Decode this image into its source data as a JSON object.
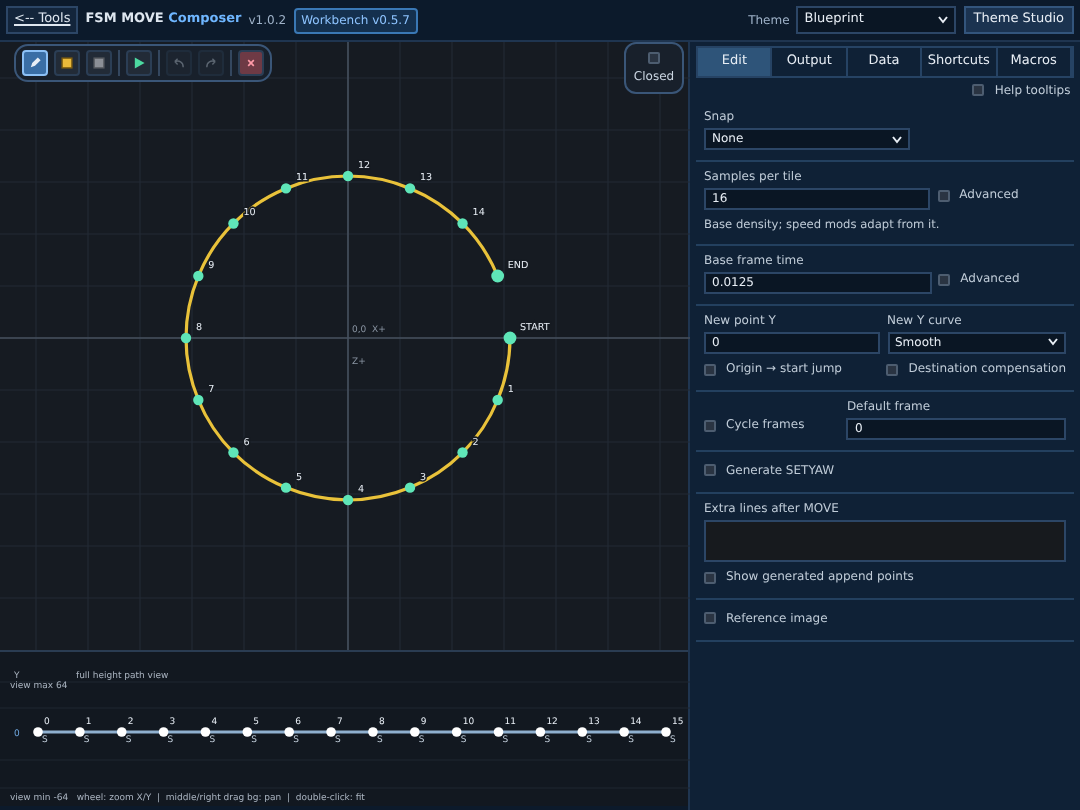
{
  "header": {
    "back_link": "<-- Tools",
    "title": "FSM MOVE",
    "title_accent": "Composer",
    "version": "v1.0.2",
    "badge": "Workbench v0.5.7",
    "theme_label": "Theme",
    "theme_value": "Blueprint",
    "theme_button": "Theme Studio"
  },
  "toolbar": [
    {
      "kind": "draw",
      "selected": true,
      "disabled": false
    },
    {
      "kind": "point",
      "selected": false,
      "disabled": false
    },
    {
      "kind": "erase",
      "selected": false,
      "disabled": false
    },
    {
      "kind": "play",
      "selected": false,
      "disabled": false
    },
    {
      "kind": "undo",
      "selected": false,
      "disabled": true
    },
    {
      "kind": "redo",
      "selected": false,
      "disabled": true
    },
    {
      "kind": "clear",
      "selected": false,
      "disabled": false
    }
  ],
  "closed_toggle": {
    "label": "Closed",
    "checked": false
  },
  "canvas": {
    "origin_label": "0,0  X+",
    "z_label": "Z+",
    "points": [
      "START",
      "1",
      "2",
      "3",
      "4",
      "5",
      "6",
      "7",
      "8",
      "9",
      "10",
      "11",
      "12",
      "13",
      "14",
      "END"
    ]
  },
  "timeline": {
    "y_label": "Y",
    "title": "full height path view",
    "max_label": "view max 64",
    "zero_label": "0",
    "points": [
      {
        "label": "0",
        "curve": "S"
      },
      {
        "label": "1",
        "curve": "S"
      },
      {
        "label": "2",
        "curve": "S"
      },
      {
        "label": "3",
        "curve": "S"
      },
      {
        "label": "4",
        "curve": "S"
      },
      {
        "label": "5",
        "curve": "S"
      },
      {
        "label": "6",
        "curve": "S"
      },
      {
        "label": "7",
        "curve": "S"
      },
      {
        "label": "8",
        "curve": "S"
      },
      {
        "label": "9",
        "curve": "S"
      },
      {
        "label": "10",
        "curve": "S"
      },
      {
        "label": "11",
        "curve": "S"
      },
      {
        "label": "12",
        "curve": "S"
      },
      {
        "label": "13",
        "curve": "S"
      },
      {
        "label": "14",
        "curve": "S"
      },
      {
        "label": "15",
        "curve": "S"
      }
    ],
    "footer": "view min -64   wheel: zoom X/Y  |  middle/right drag bg: pan  |  double-click: fit"
  },
  "tabs": [
    {
      "label": "Edit",
      "selected": true
    },
    {
      "label": "Output",
      "selected": false
    },
    {
      "label": "Data",
      "selected": false
    },
    {
      "label": "Shortcuts",
      "selected": false
    },
    {
      "label": "Macros",
      "selected": false
    }
  ],
  "help_tooltips": {
    "label": "Help tooltips",
    "checked": false
  },
  "sections": [
    {
      "rows": [
        [
          {
            "kind": "select",
            "label": "Snap",
            "value": "None"
          },
          {
            "kind": "empty"
          }
        ]
      ]
    },
    {
      "rows": [
        [
          {
            "kind": "input",
            "label": "Samples per tile",
            "value": "16"
          },
          {
            "kind": "checkbox",
            "label": "Advanced",
            "checked": false
          }
        ],
        [
          {
            "kind": "note",
            "text": "Base density; speed mods adapt from it."
          }
        ]
      ]
    },
    {
      "rows": [
        [
          {
            "kind": "input",
            "label": "Base frame time",
            "value": "0.0125"
          },
          {
            "kind": "checkbox",
            "label": "Advanced",
            "checked": false
          }
        ]
      ]
    },
    {
      "rows": [
        [
          {
            "kind": "input",
            "label": "New point Y",
            "value": "0"
          },
          {
            "kind": "select",
            "label": "New Y curve",
            "value": "Smooth"
          }
        ],
        [
          {
            "kind": "checkbox",
            "label": "Origin → start jump",
            "checked": false
          },
          {
            "kind": "checkbox",
            "label": "Destination compensation",
            "checked": false
          }
        ]
      ]
    },
    {
      "rows": [
        [
          {
            "kind": "checkbox",
            "label": "Cycle frames",
            "checked": false
          },
          {
            "kind": "input",
            "label": "Default frame",
            "value": "0"
          }
        ]
      ]
    },
    {
      "rows": [
        [
          {
            "kind": "checkbox",
            "label": "Generate SETYAW",
            "checked": false
          }
        ]
      ]
    },
    {
      "rows": [
        [
          {
            "kind": "textarea",
            "label": "Extra lines after MOVE"
          }
        ],
        [
          {
            "kind": "checkbox",
            "label": "Show generated append points",
            "checked": false
          }
        ]
      ]
    },
    {
      "rows": [
        [
          {
            "kind": "checkbox",
            "label": "Reference image",
            "checked": false
          }
        ]
      ]
    }
  ]
}
